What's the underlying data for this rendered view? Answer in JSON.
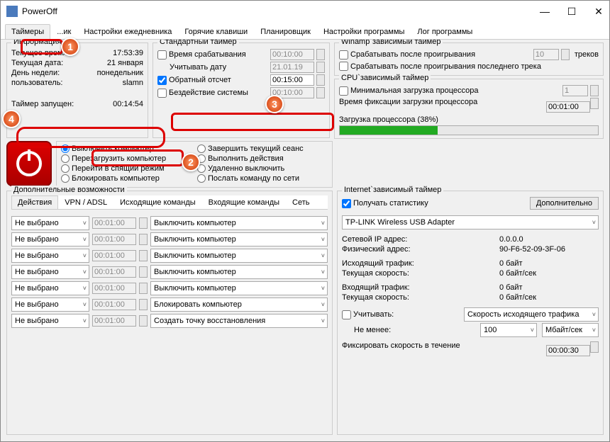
{
  "window": {
    "title": "PowerOff"
  },
  "tabs": {
    "items": [
      "Таймеры",
      "...ик",
      "Настройки ежедневника",
      "Горячие клавиши",
      "Планировщик",
      "Настройки программы",
      "Лог программы"
    ],
    "active": 0
  },
  "info": {
    "title": "Информация",
    "rows": [
      {
        "k": "Текущее время:",
        "v": "17:53:39"
      },
      {
        "k": "Текущая дата:",
        "v": "21 января"
      },
      {
        "k": "День недели:",
        "v": "понедельник"
      },
      {
        "k": "пользователь:",
        "v": "slamn"
      }
    ],
    "timer_started_k": "Таймер запущен:",
    "timer_started_v": "00:14:54"
  },
  "std": {
    "title": "Стандартный таймер",
    "trigger_time": "Время срабатывания",
    "trigger_time_v": "00:10:00",
    "use_date": "Учитывать дату",
    "use_date_v": "21.01.19",
    "countdown": "Обратный отсчет",
    "countdown_v": "00:15:00",
    "idle": "Бездействие системы",
    "idle_v": "00:10:00"
  },
  "actions": {
    "col1": [
      "Выключить компьютер",
      "Перезагрузить компьютер",
      "Перейти в спящий режим",
      "Блокировать компьютер"
    ],
    "col2": [
      "Завершить текущий сеанс",
      "Выполнить действия",
      "Удаленно выключить",
      "Послать команду по сети"
    ]
  },
  "winamp": {
    "title": "Winamp`зависимый таймер",
    "after_play": "Срабатывать после проигрывания",
    "tracks_v": "10",
    "tracks_l": "треков",
    "after_last": "Срабатывать после проигрывания последнего трека"
  },
  "cpu": {
    "title": "CPU`зависимый таймер",
    "min_load": "Минимальная загрузка процессора",
    "min_load_v": "1",
    "fix_time": "Время фиксации загрузки процессора",
    "fix_time_v": "00:01:00",
    "load_label": "Загрузка процессора (38%)",
    "load_pct": 38
  },
  "extra": {
    "title": "Дополнительные возможности",
    "subtabs": [
      "Действия",
      "VPN / ADSL",
      "Исходящие команды",
      "Входящие команды",
      "Сеть"
    ],
    "not_selected": "Не выбрано",
    "default_time": "00:01:00",
    "shutdown": "Выключить компьютер",
    "block": "Блокировать компьютер",
    "restore": "Создать точку восстановления"
  },
  "net": {
    "title": "Internet`зависимый таймер",
    "get_stats": "Получать статистику",
    "more_btn": "Дополнительно",
    "adapter": "TP-LINK Wireless USB Adapter",
    "rows": [
      {
        "k": "Сетевой IP адрес:",
        "v": "0.0.0.0"
      },
      {
        "k": "Физический адрес:",
        "v": "90-F6-52-09-3F-06"
      },
      {
        "k": "Исходящий трафик:",
        "v": "0 байт"
      },
      {
        "k": "Текущая скорость:",
        "v": "0 байт/сек"
      },
      {
        "k": "Входящий трафик:",
        "v": "0 байт"
      },
      {
        "k": "Текущая скорость:",
        "v": "0 байт/сек"
      }
    ],
    "account": "Учитывать:",
    "account_v": "Скорость исходящего трафика",
    "atleast": "Не менее:",
    "atleast_v": "100",
    "unit": "Мбайт/сек",
    "fix_speed": "Фиксировать скорость в течение",
    "fix_speed_v": "00:00:30"
  },
  "annotations": {
    "1": "1",
    "2": "2",
    "3": "3",
    "4": "4"
  }
}
